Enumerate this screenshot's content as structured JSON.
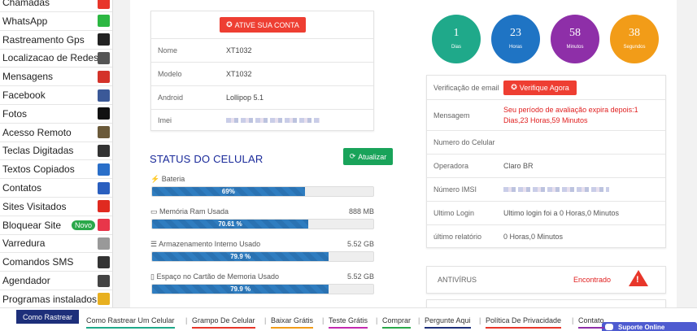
{
  "sidebar": {
    "items": [
      {
        "label": "Chamadas",
        "icon": "phone-icon",
        "color": "#e8362a"
      },
      {
        "label": "WhatsApp",
        "icon": "whatsapp-icon",
        "color": "#2cb742"
      },
      {
        "label": "Rastreamento Gps",
        "icon": "map-pin-icon",
        "color": "#222222"
      },
      {
        "label": "Localizacao de Redes",
        "icon": "wifi-icon",
        "color": "#555555"
      },
      {
        "label": "Mensagens",
        "icon": "envelope-icon",
        "color": "#d4332a"
      },
      {
        "label": "Facebook",
        "icon": "facebook-icon",
        "color": "#3b5998"
      },
      {
        "label": "Fotos",
        "icon": "camera-icon",
        "color": "#111111"
      },
      {
        "label": "Acesso Remoto",
        "icon": "remote-icon",
        "color": "#6b5a3a"
      },
      {
        "label": "Teclas Digitadas",
        "icon": "keyboard-icon",
        "color": "#333333"
      },
      {
        "label": "Textos Copiados",
        "icon": "pencil-icon",
        "color": "#2a6fc9"
      },
      {
        "label": "Contatos",
        "icon": "contacts-icon",
        "color": "#2a5fbf"
      },
      {
        "label": "Sites Visitados",
        "icon": "youtube-icon",
        "color": "#e02a20"
      },
      {
        "label": "Bloquear Site",
        "icon": "lock-icon",
        "color": "#e8364a",
        "badge": "Novo"
      },
      {
        "label": "Varredura",
        "icon": "search-icon",
        "color": "#999999"
      },
      {
        "label": "Comandos SMS",
        "icon": "sms-icon",
        "color": "#333333"
      },
      {
        "label": "Agendador",
        "icon": "calendar-icon",
        "color": "#444444"
      },
      {
        "label": "Programas instalados",
        "icon": "star-icon",
        "color": "#e8b020"
      }
    ]
  },
  "device_info": {
    "activate_label": "ATIVE SUA CONTA",
    "rows": [
      {
        "key": "Nome",
        "value": "XT1032"
      },
      {
        "key": "Modelo",
        "value": "XT1032"
      },
      {
        "key": "Android",
        "value": "Lollipop 5.1"
      },
      {
        "key": "Imei",
        "value": ""
      }
    ]
  },
  "status": {
    "title": "STATUS DO CELULAR",
    "refresh_label": "Atualizar",
    "metrics": [
      {
        "label": "Bateria",
        "value": "",
        "percent_label": "69%",
        "percent": 69
      },
      {
        "label": "Memória Ram Usada",
        "value": "888 MB",
        "percent_label": "70.61 %",
        "percent": 70.61
      },
      {
        "label": "Armazenamento Interno Usado",
        "value": "5.52 GB",
        "percent_label": "79.9 %",
        "percent": 79.9
      },
      {
        "label": "Espaço no Cartão de Memoria Usado",
        "value": "5.52 GB",
        "percent_label": "79.9 %",
        "percent": 79.9
      }
    ]
  },
  "countdown": [
    {
      "value": "1",
      "unit": "Dias",
      "color": "#1fa98a"
    },
    {
      "value": "23",
      "unit": "Horas",
      "color": "#1f74c4"
    },
    {
      "value": "58",
      "unit": "Minutos",
      "color": "#8e2fa8"
    },
    {
      "value": "38",
      "unit": "Segundos",
      "color": "#f29c18"
    }
  ],
  "account": {
    "rows": [
      {
        "key": "Verificação de email",
        "value": "",
        "button": "Verifique Agora"
      },
      {
        "key": "Mensagem",
        "value": "Seu período de avaliação expira depois:1 Dias,23 Horas,59 Minutos",
        "alert": true
      },
      {
        "key": "Numero do Celular",
        "value": ""
      },
      {
        "key": "Operadora",
        "value": "Claro BR"
      },
      {
        "key": "Número IMSI",
        "value": ""
      },
      {
        "key": "Ultimo Login",
        "value": "Ultimo login foi a 0 Horas,0 Minutos"
      },
      {
        "key": "último relatório",
        "value": "0 Horas,0 Minutos"
      }
    ]
  },
  "antivirus": {
    "label": "ANTIVÍRUS",
    "status": "Encontrado"
  },
  "footer": {
    "brand": "Como Rastrear",
    "links": [
      {
        "label": "Como Rastrear Um Celular",
        "color": "#1fa98a"
      },
      {
        "label": "Grampo De Celular",
        "color": "#e8362a"
      },
      {
        "label": "Baixar Grátis",
        "color": "#f29c18"
      },
      {
        "label": "Teste Grátis",
        "color": "#c32ab0"
      },
      {
        "label": "Comprar",
        "color": "#2aa84a"
      },
      {
        "label": "Pergunte Aqui",
        "color": "#1d2f7a"
      },
      {
        "label": "Política De Privacidade",
        "color": "#e8362a"
      },
      {
        "label": "Contato",
        "color": "#8e2fa8"
      }
    ],
    "support": "Suporte Online"
  }
}
